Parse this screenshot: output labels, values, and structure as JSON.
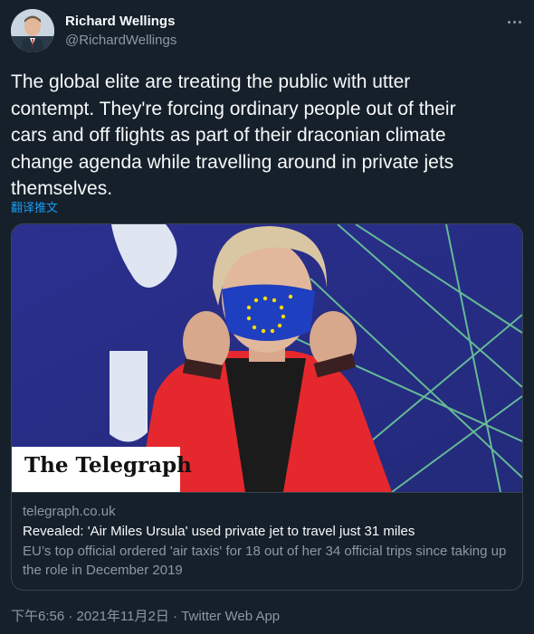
{
  "author": {
    "name": "Richard Wellings",
    "handle": "@RichardWellings"
  },
  "tweet": {
    "text": "The global elite are treating the public with utter\ncontempt. They're forcing ordinary people out of their\ncars and off flights as part of their draconian climate\nchange agenda while travelling around in private jets\nthemselves.",
    "translate_label": "翻译推文"
  },
  "card": {
    "image_badge": "The Telegraph",
    "domain": "telegraph.co.uk",
    "headline": "Revealed: 'Air Miles Ursula' used private jet to travel just 31 miles",
    "description": "EU’s top official ordered 'air taxis' for 18 out of her 34 official trips since taking up the role in December 2019"
  },
  "footer": {
    "time": "下午6:56",
    "date": "2021年11月2日",
    "app": "Twitter Web App",
    "separator": "·"
  },
  "icons": {
    "more": "more-horizontal-icon"
  },
  "colors": {
    "background": "#15202b",
    "text": "#f7f9f9",
    "secondary": "#8b98a5",
    "link": "#1d9bf0",
    "border": "#38444d"
  }
}
